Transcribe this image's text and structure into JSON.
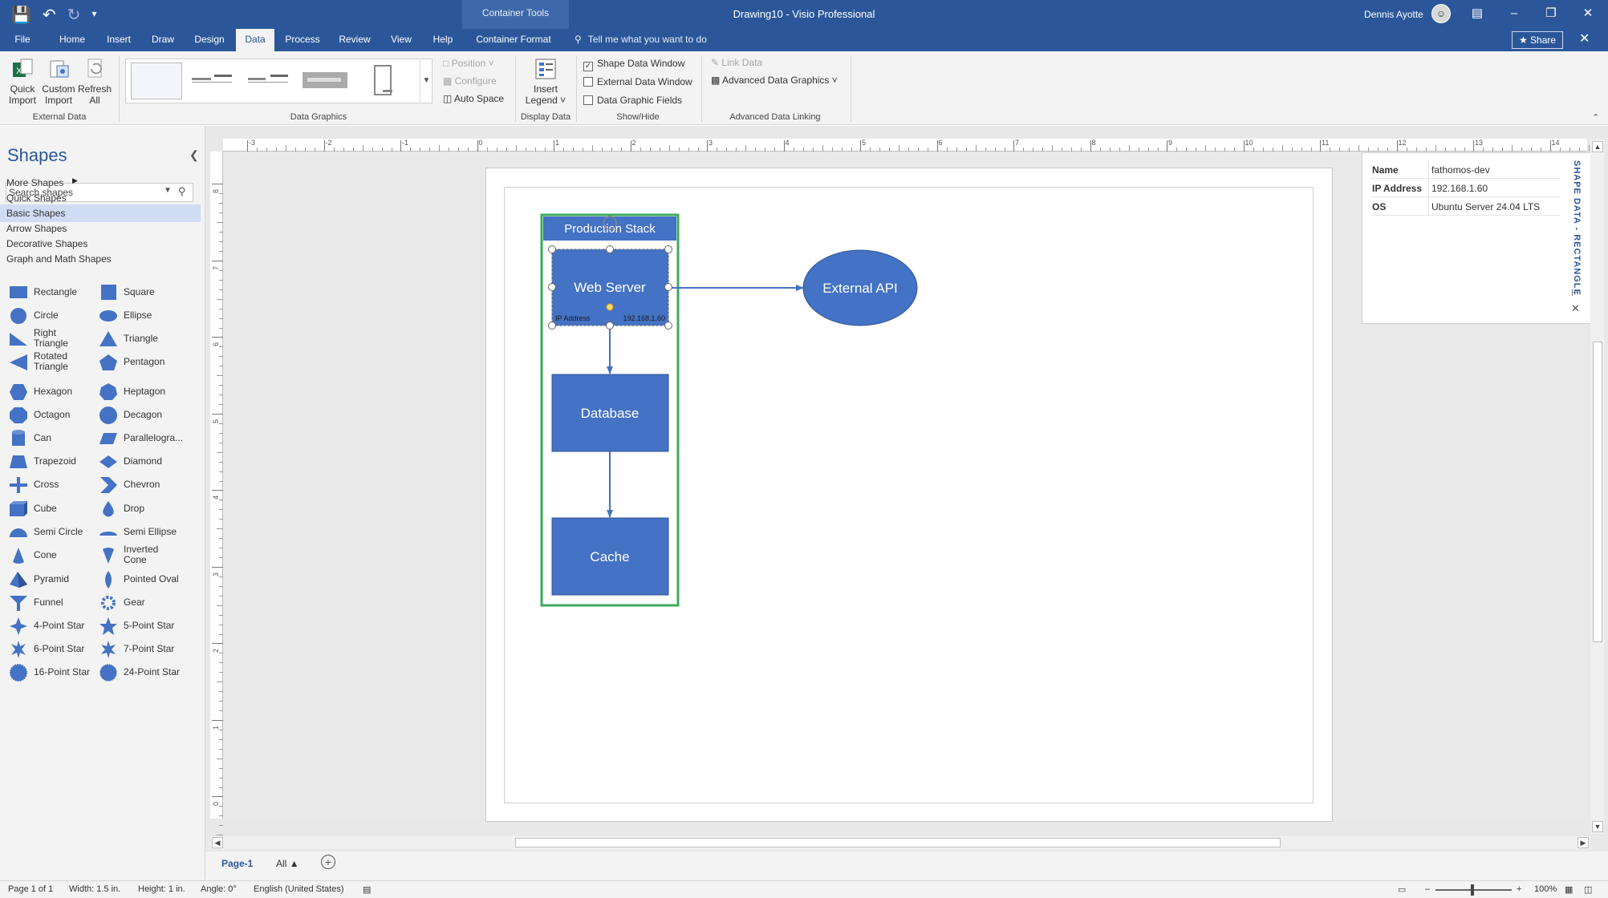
{
  "app": {
    "doc_title": "Drawing10  -  Visio Professional",
    "context_tab_title": "Container Tools",
    "user": "Dennis Ayotte"
  },
  "tabs": [
    "File",
    "Home",
    "Insert",
    "Draw",
    "Design",
    "Data",
    "Process",
    "Review",
    "View",
    "Help",
    "Container Format"
  ],
  "active_tab": "Data",
  "tell_me": "Tell me what you want to do",
  "share": "Share",
  "ribbon": {
    "external_data": {
      "label": "External Data",
      "quick_import": "Quick Import",
      "custom_import": "Custom Import",
      "refresh_all": "Refresh All"
    },
    "data_graphics": {
      "label": "Data Graphics",
      "position": "Position",
      "configure": "Configure",
      "auto_space": "Auto Space"
    },
    "display_data": {
      "label": "Display Data",
      "insert_legend": "Insert Legend"
    },
    "show_hide": {
      "label": "Show/Hide",
      "shape_data_window": "Shape Data Window",
      "shape_data_window_checked": true,
      "external_data_window": "External Data Window",
      "external_data_window_checked": false,
      "data_graphic_fields": "Data Graphic Fields",
      "data_graphic_fields_checked": false
    },
    "advanced_linking": {
      "label": "Advanced Data Linking",
      "link_data": "Link Data",
      "advanced_data_graphics": "Advanced Data Graphics"
    }
  },
  "shapes_panel": {
    "title": "Shapes",
    "search_placeholder": "Search shapes",
    "stencils": [
      "More Shapes",
      "Quick Shapes",
      "Basic Shapes",
      "Arrow Shapes",
      "Decorative Shapes",
      "Graph and Math Shapes"
    ],
    "active_stencil": "Basic Shapes",
    "shapes": [
      [
        "Rectangle",
        "Square"
      ],
      [
        "Circle",
        "Ellipse"
      ],
      [
        "Right Triangle",
        "Triangle"
      ],
      [
        "Rotated Triangle",
        "Pentagon"
      ],
      [
        "Hexagon",
        "Heptagon"
      ],
      [
        "Octagon",
        "Decagon"
      ],
      [
        "Can",
        "Parallelogra..."
      ],
      [
        "Trapezoid",
        "Diamond"
      ],
      [
        "Cross",
        "Chevron"
      ],
      [
        "Cube",
        "Drop"
      ],
      [
        "Semi Circle",
        "Semi Ellipse"
      ],
      [
        "Cone",
        "Inverted Cone"
      ],
      [
        "Pyramid",
        "Pointed Oval"
      ],
      [
        "Funnel",
        "Gear"
      ],
      [
        "4-Point Star",
        "5-Point Star"
      ],
      [
        "6-Point Star",
        "7-Point Star"
      ],
      [
        "16-Point Star",
        "24-Point Star"
      ]
    ]
  },
  "ruler": {
    "horizontal": [
      "-3",
      "-2",
      "-1",
      "0",
      "1",
      "2",
      "3",
      "4",
      "5",
      "6",
      "7",
      "8",
      "9",
      "10",
      "11",
      "12",
      "13",
      "14"
    ],
    "vertical": [
      "8",
      "7",
      "6",
      "5",
      "4",
      "3",
      "2",
      "1",
      "0"
    ]
  },
  "diagram": {
    "container_title": "Production Stack",
    "web_server": "Web Server",
    "web_server_field_label": "IP Address",
    "web_server_field_value": "192.168.1.60",
    "database": "Database",
    "cache": "Cache",
    "external_api": "External API",
    "shape_fill": "#4472c4",
    "container_border": "#3aaa5c"
  },
  "shape_data": {
    "title": "SHAPE DATA - RECTANGLE",
    "rows": [
      {
        "key": "Name",
        "value": "fathomos-dev"
      },
      {
        "key": "IP Address",
        "value": "192.168.1.60"
      },
      {
        "key": "OS",
        "value": "Ubuntu Server 24.04 LTS"
      }
    ]
  },
  "page_tabs": {
    "current": "Page-1",
    "all": "All"
  },
  "status": {
    "page": "Page 1 of 1",
    "width": "Width: 1.5 in.",
    "height": "Height: 1 in.",
    "angle": "Angle: 0°",
    "language": "English (United States)",
    "zoom": "100%"
  },
  "colors": {
    "brand": "#2b579a",
    "ribbon_bg": "#f3f3f3"
  }
}
